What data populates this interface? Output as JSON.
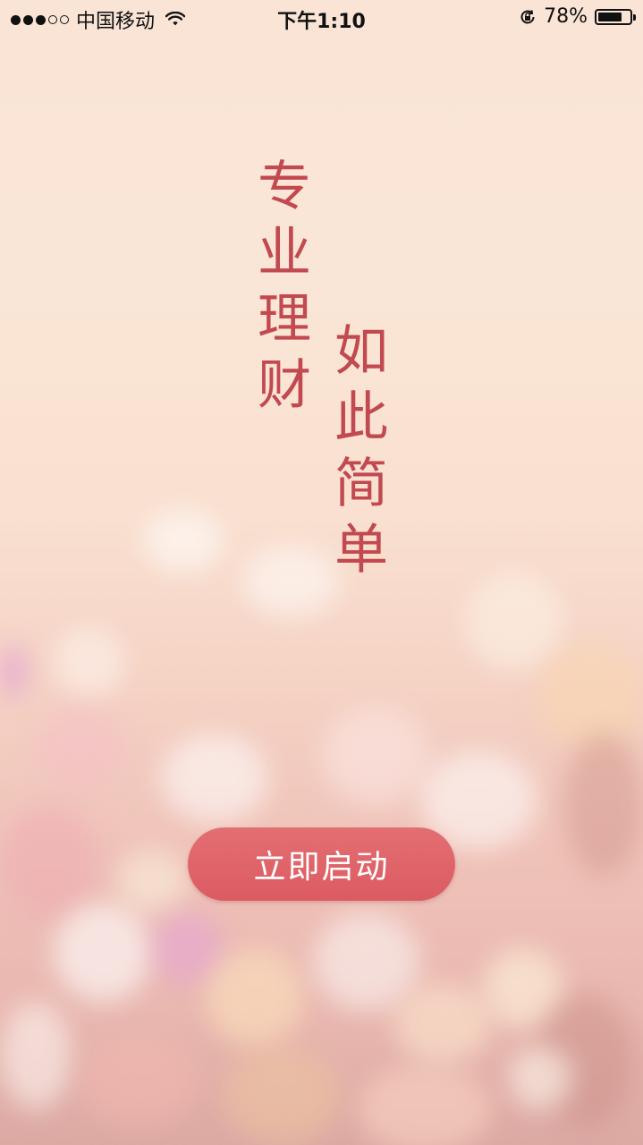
{
  "status_bar": {
    "carrier": "中国移动",
    "time": "下午1:10",
    "battery_percent": "78%",
    "battery_level": 0.78,
    "signal_bars_filled": 3,
    "signal_bars_total": 5,
    "icons": [
      "wifi-icon",
      "lock-rotation-icon",
      "battery-icon"
    ]
  },
  "slogan": {
    "line1": [
      "专",
      "业",
      "理",
      "财"
    ],
    "line2": [
      "如",
      "此",
      "简",
      "单"
    ]
  },
  "start_button": {
    "label": "立即启动"
  },
  "colors": {
    "accent": "#dc5b63",
    "slogan_text": "#c1494f",
    "background_top": "#f9e4d6",
    "background_bottom": "#dca9a3"
  }
}
